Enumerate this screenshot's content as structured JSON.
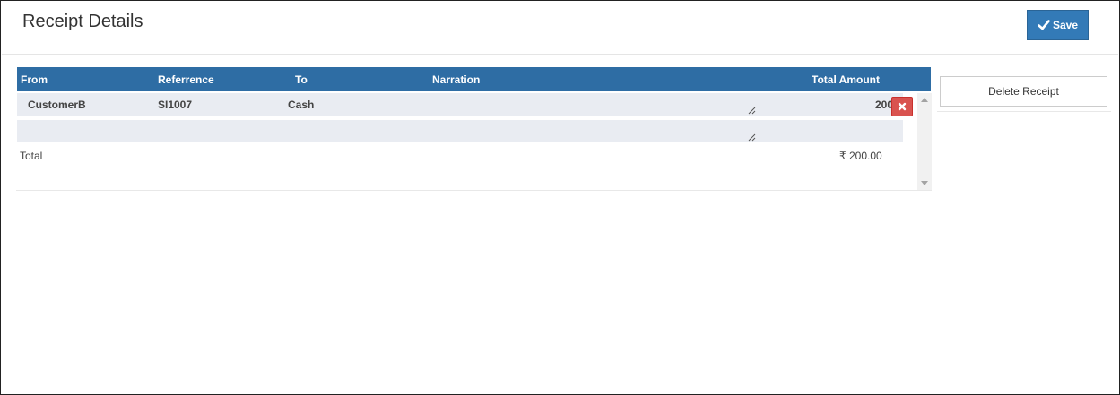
{
  "header": {
    "title": "Receipt Details",
    "save_label": "Save"
  },
  "grid": {
    "columns": [
      "From",
      "Referrence",
      "To",
      "Narration",
      "Total Amount"
    ],
    "rows": [
      {
        "from": "CustomerB",
        "reference": "SI1007",
        "to": "Cash",
        "narration": "",
        "amount": "200"
      },
      {
        "from": "",
        "reference": "",
        "to": "",
        "narration": "",
        "amount": ""
      }
    ],
    "total_label": "Total",
    "total_value": "₹ 200.00"
  },
  "actions": {
    "delete_receipt_label": "Delete Receipt"
  },
  "icons": {
    "save": "check-icon",
    "delete_row": "close-icon"
  },
  "colors": {
    "primary": "#337ab7",
    "header_bg": "#2e6da4",
    "danger": "#d9534f",
    "row_bg": "#e9ecf2"
  }
}
